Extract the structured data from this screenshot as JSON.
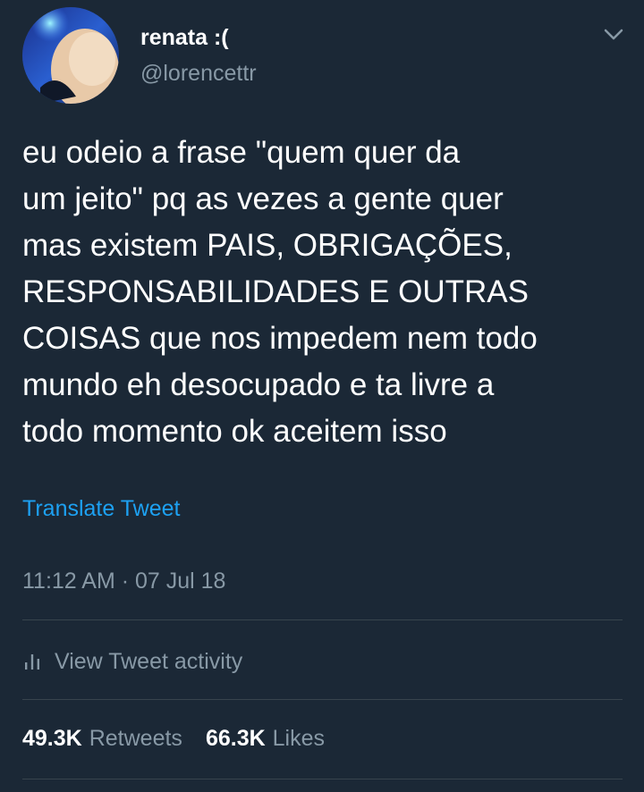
{
  "author": {
    "display_name": "renata :(",
    "handle": "@lorencettr"
  },
  "tweet": {
    "lines": [
      "eu odeio a frase \"quem quer da",
      "um jeito\" pq as vezes a gente quer",
      "mas existem PAIS, OBRIGAÇÕES,",
      "RESPONSABILIDADES E OUTRAS",
      "COISAS que nos impedem nem todo",
      "mundo eh desocupado e ta livre a",
      "todo momento ok aceitem isso"
    ],
    "translate_label": "Translate Tweet",
    "timestamp": "11:12 AM · 07 Jul 18"
  },
  "activity": {
    "label": "View Tweet activity",
    "icon": "bar-chart-icon"
  },
  "stats": {
    "retweets_value": "49.3K",
    "retweets_label": "Retweets",
    "likes_value": "66.3K",
    "likes_label": "Likes"
  },
  "colors": {
    "background": "#1b2836",
    "text_primary": "#ffffff",
    "text_secondary": "#8899a6",
    "link": "#1da1f2",
    "divider": "#38444d"
  },
  "icons": {
    "menu": "chevron-down-icon"
  }
}
